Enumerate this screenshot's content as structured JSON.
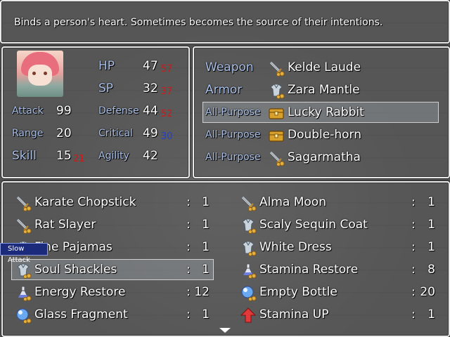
{
  "help_text": "Binds a person's heart. Sometimes becomes the source of their intentions.",
  "status": {
    "hp": {
      "label": "HP",
      "value": "47",
      "bonus": "57"
    },
    "sp": {
      "label": "SP",
      "value": "32",
      "bonus": "37"
    },
    "attack": {
      "label": "Attack",
      "value": "99"
    },
    "defense": {
      "label": "Defense",
      "value": "44",
      "bonus": "52"
    },
    "range": {
      "label": "Range",
      "value": "20"
    },
    "critical": {
      "label": "Critical",
      "value": "49",
      "bonus": "30"
    },
    "skill": {
      "label": "Skill",
      "value": "15",
      "bonus": "21"
    },
    "agility": {
      "label": "Agility",
      "value": "42"
    }
  },
  "equipment": [
    {
      "slot": "Weapon",
      "item": "Kelde Laude",
      "icon": "sword-icon"
    },
    {
      "slot": "Armor",
      "item": "Zara Mantle",
      "icon": "armor-icon"
    },
    {
      "slot": "All-Purpose",
      "item": "Lucky Rabbit",
      "icon": "chest-icon"
    },
    {
      "slot": "All-Purpose",
      "item": "Double-horn",
      "icon": "chest-icon"
    },
    {
      "slot": "All-Purpose",
      "item": "Sagarmatha",
      "icon": "sword-icon"
    }
  ],
  "inventory": [
    {
      "name": "Karate Chopstick",
      "qty": "1",
      "icon": "sword-icon"
    },
    {
      "name": "Alma Moon",
      "qty": "1",
      "icon": "sword-icon"
    },
    {
      "name": "Rat Slayer",
      "qty": "1",
      "icon": "sword-icon"
    },
    {
      "name": "Scaly Sequin Coat",
      "qty": "1",
      "icon": "armor-icon"
    },
    {
      "name": "Fine Pajamas",
      "qty": "1",
      "icon": "armor-icon"
    },
    {
      "name": "White Dress",
      "qty": "1",
      "icon": "armor-icon"
    },
    {
      "name": "Soul Shackles",
      "qty": "1",
      "icon": "armor-icon"
    },
    {
      "name": "Stamina Restore",
      "qty": "8",
      "icon": "potion-icon"
    },
    {
      "name": "Energy Restore",
      "qty": "12",
      "icon": "potion-icon"
    },
    {
      "name": "Empty Bottle",
      "qty": "20",
      "icon": "orb-icon"
    },
    {
      "name": "Glass Fragment",
      "qty": "1",
      "icon": "orb-icon"
    },
    {
      "name": "Stamina UP",
      "qty": "1",
      "icon": "up-arrow-icon"
    }
  ],
  "qty_separator": ":",
  "tooltip": "Slow Attack",
  "colors": {
    "label_blue": "#a9bfe6",
    "bonus_red": "#d01818",
    "bonus_blue": "#1f3fd0"
  }
}
